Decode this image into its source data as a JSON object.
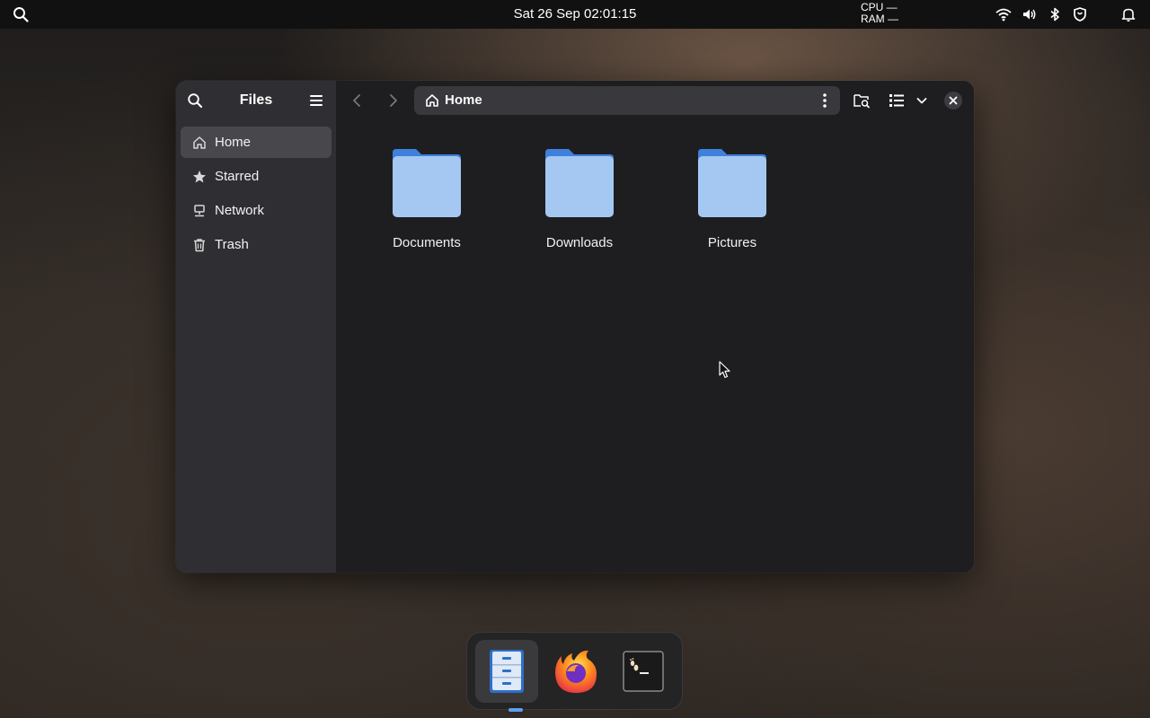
{
  "topbar": {
    "clock": "Sat 26 Sep  02:01:15",
    "cpu": "CPU —",
    "ram": "RAM —",
    "icons": [
      "search-icon",
      "wifi-icon",
      "volume-icon",
      "bluetooth-icon",
      "shield-icon",
      "bell-icon"
    ]
  },
  "window": {
    "sidebar": {
      "title": "Files",
      "items": [
        {
          "label": "Home",
          "icon": "home-icon",
          "active": true
        },
        {
          "label": "Starred",
          "icon": "star-icon",
          "active": false
        },
        {
          "label": "Network",
          "icon": "network-icon",
          "active": false
        },
        {
          "label": "Trash",
          "icon": "trash-icon",
          "active": false
        }
      ]
    },
    "header": {
      "path": "Home",
      "icons": [
        "back-arrow-icon",
        "forward-arrow-icon",
        "kebab-menu-icon",
        "folder-search-icon",
        "list-view-icon",
        "chevron-down-icon",
        "close-icon"
      ]
    },
    "folders": [
      {
        "name": "Documents"
      },
      {
        "name": "Downloads"
      },
      {
        "name": "Pictures"
      }
    ]
  },
  "dock": {
    "apps": [
      "files-icon",
      "firefox-icon",
      "terminal-icon"
    ],
    "indicator_color": "#5ea1f0"
  },
  "colors": {
    "folder_back": "#3e80dc",
    "folder_front": "#a4c8f2",
    "sidebar_bg": "#2f2f33",
    "content_bg": "#1e1e21"
  }
}
